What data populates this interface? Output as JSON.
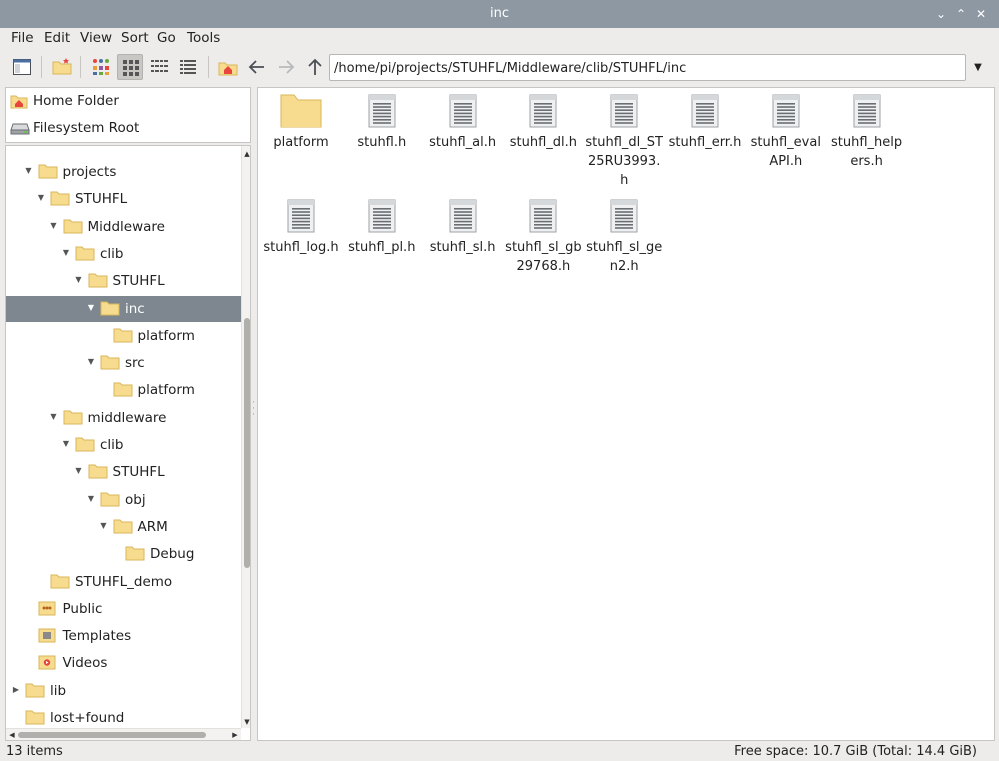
{
  "window": {
    "title": "inc"
  },
  "menu": [
    "File",
    "Edit",
    "View",
    "Sort",
    "Go",
    "Tools"
  ],
  "path": {
    "value": "/home/pi/projects/STUHFL/Middleware/clib/STUHFL/inc"
  },
  "places": [
    {
      "label": "Home Folder",
      "icon": "home-folder-icon"
    },
    {
      "label": "Filesystem Root",
      "icon": "drive-icon"
    }
  ],
  "tree": [
    {
      "label": "projects",
      "depth": 2,
      "expander": "open",
      "icon": "folder"
    },
    {
      "label": "STUHFL",
      "depth": 3,
      "expander": "open",
      "icon": "folder"
    },
    {
      "label": "Middleware",
      "depth": 4,
      "expander": "open",
      "icon": "folder"
    },
    {
      "label": "clib",
      "depth": 5,
      "expander": "open",
      "icon": "folder"
    },
    {
      "label": "STUHFL",
      "depth": 6,
      "expander": "open",
      "icon": "folder"
    },
    {
      "label": "inc",
      "depth": 7,
      "expander": "open",
      "icon": "folder",
      "selected": true
    },
    {
      "label": "platform",
      "depth": 8,
      "expander": "none",
      "icon": "folder"
    },
    {
      "label": "src",
      "depth": 7,
      "expander": "open",
      "icon": "folder"
    },
    {
      "label": "platform",
      "depth": 8,
      "expander": "none",
      "icon": "folder"
    },
    {
      "label": "middleware",
      "depth": 4,
      "expander": "open",
      "icon": "folder"
    },
    {
      "label": "clib",
      "depth": 5,
      "expander": "open",
      "icon": "folder"
    },
    {
      "label": "STUHFL",
      "depth": 6,
      "expander": "open",
      "icon": "folder"
    },
    {
      "label": "obj",
      "depth": 7,
      "expander": "open",
      "icon": "folder"
    },
    {
      "label": "ARM",
      "depth": 8,
      "expander": "open",
      "icon": "folder"
    },
    {
      "label": "Debug",
      "depth": 9,
      "expander": "none",
      "icon": "folder"
    },
    {
      "label": "STUHFL_demo",
      "depth": 3,
      "expander": "none",
      "icon": "folder"
    },
    {
      "label": "Public",
      "depth": 2,
      "expander": "none",
      "icon": "public"
    },
    {
      "label": "Templates",
      "depth": 2,
      "expander": "none",
      "icon": "templates"
    },
    {
      "label": "Videos",
      "depth": 2,
      "expander": "none",
      "icon": "videos"
    },
    {
      "label": "lib",
      "depth": 1,
      "expander": "closed",
      "icon": "folder"
    },
    {
      "label": "lost+found",
      "depth": 1,
      "expander": "none",
      "icon": "folder"
    }
  ],
  "files": [
    {
      "name": "platform",
      "kind": "folder"
    },
    {
      "name": "stuhfl.h",
      "kind": "text"
    },
    {
      "name": "stuhfl_al.h",
      "kind": "text"
    },
    {
      "name": "stuhfl_dl.h",
      "kind": "text"
    },
    {
      "name": "stuhfl_dl_ST25RU3993.h",
      "kind": "text"
    },
    {
      "name": "stuhfl_err.h",
      "kind": "text"
    },
    {
      "name": "stuhfl_evalAPI.h",
      "kind": "text"
    },
    {
      "name": "stuhfl_helpers.h",
      "kind": "text"
    },
    {
      "name": "stuhfl_log.h",
      "kind": "text"
    },
    {
      "name": "stuhfl_pl.h",
      "kind": "text"
    },
    {
      "name": "stuhfl_sl.h",
      "kind": "text"
    },
    {
      "name": "stuhfl_sl_gb29768.h",
      "kind": "text"
    },
    {
      "name": "stuhfl_sl_gen2.h",
      "kind": "text"
    }
  ],
  "status": {
    "items": "13 items",
    "free": "Free space: 10.7 GiB (Total: 14.4 GiB)"
  },
  "colors": {
    "titlebar": "#8e98a3",
    "selection": "#7e8790",
    "folder": "#f7dc8f",
    "folder_edge": "#d9b658"
  }
}
